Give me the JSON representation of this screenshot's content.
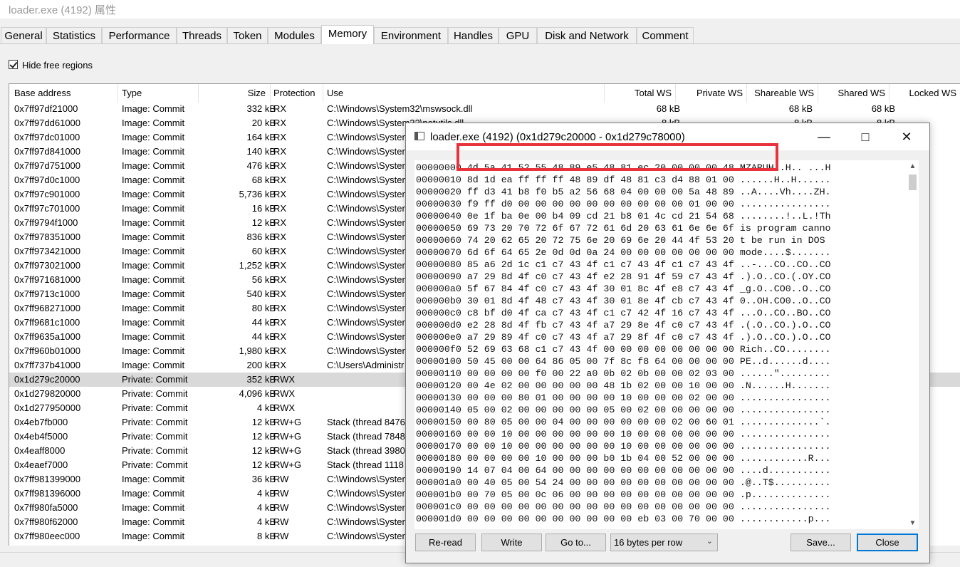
{
  "window_title": "loader.exe (4192) 属性",
  "tabs": [
    "General",
    "Statistics",
    "Performance",
    "Threads",
    "Token",
    "Modules",
    "Memory",
    "Environment",
    "Handles",
    "GPU",
    "Disk and Network",
    "Comment"
  ],
  "hide_free_label": "Hide free regions",
  "columns": [
    "Base address",
    "Type",
    "Size",
    "Protection",
    "Use",
    "Total WS",
    "Private WS",
    "Shareable WS",
    "Shared WS",
    "Locked WS"
  ],
  "rows": [
    {
      "addr": "0x7ff97df21000",
      "type": "Image: Commit",
      "size": "332 kB",
      "prot": "RX",
      "use": "C:\\Windows\\System32\\mswsock.dll",
      "tws": "68 kB",
      "sws": "68 kB",
      "shd": "68 kB"
    },
    {
      "addr": "0x7ff97dd61000",
      "type": "Image: Commit",
      "size": "20 kB",
      "prot": "RX",
      "use": "C:\\Windows\\System32\\netutils.dll",
      "tws": "8 kB",
      "sws": "8 kB",
      "shd": "8 kB"
    },
    {
      "addr": "0x7ff97dc01000",
      "type": "Image: Commit",
      "size": "164 kB",
      "prot": "RX",
      "use": "C:\\Windows\\System",
      "tws": "",
      "sws": "",
      "shd": ""
    },
    {
      "addr": "0x7ff97d841000",
      "type": "Image: Commit",
      "size": "140 kB",
      "prot": "RX",
      "use": "C:\\Windows\\System",
      "tws": "",
      "sws": "",
      "shd": ""
    },
    {
      "addr": "0x7ff97d751000",
      "type": "Image: Commit",
      "size": "476 kB",
      "prot": "RX",
      "use": "C:\\Windows\\System",
      "tws": "",
      "sws": "",
      "shd": ""
    },
    {
      "addr": "0x7ff97d0c1000",
      "type": "Image: Commit",
      "size": "68 kB",
      "prot": "RX",
      "use": "C:\\Windows\\System",
      "tws": "",
      "sws": "",
      "shd": ""
    },
    {
      "addr": "0x7ff97c901000",
      "type": "Image: Commit",
      "size": "5,736 kB",
      "prot": "RX",
      "use": "C:\\Windows\\System",
      "tws": "",
      "sws": "",
      "shd": ""
    },
    {
      "addr": "0x7ff97c701000",
      "type": "Image: Commit",
      "size": "16 kB",
      "prot": "RX",
      "use": "C:\\Windows\\System",
      "tws": "",
      "sws": "",
      "shd": ""
    },
    {
      "addr": "0x7ff9794f1000",
      "type": "Image: Commit",
      "size": "12 kB",
      "prot": "RX",
      "use": "C:\\Windows\\System",
      "tws": "",
      "sws": "",
      "shd": ""
    },
    {
      "addr": "0x7ff978351000",
      "type": "Image: Commit",
      "size": "836 kB",
      "prot": "RX",
      "use": "C:\\Windows\\System",
      "tws": "",
      "sws": "",
      "shd": ""
    },
    {
      "addr": "0x7ff973421000",
      "type": "Image: Commit",
      "size": "60 kB",
      "prot": "RX",
      "use": "C:\\Windows\\System",
      "tws": "",
      "sws": "",
      "shd": ""
    },
    {
      "addr": "0x7ff973021000",
      "type": "Image: Commit",
      "size": "1,252 kB",
      "prot": "RX",
      "use": "C:\\Windows\\System",
      "tws": "",
      "sws": "",
      "shd": ""
    },
    {
      "addr": "0x7ff971681000",
      "type": "Image: Commit",
      "size": "56 kB",
      "prot": "RX",
      "use": "C:\\Windows\\System",
      "tws": "",
      "sws": "",
      "shd": ""
    },
    {
      "addr": "0x7ff9713c1000",
      "type": "Image: Commit",
      "size": "540 kB",
      "prot": "RX",
      "use": "C:\\Windows\\System",
      "tws": "",
      "sws": "",
      "shd": ""
    },
    {
      "addr": "0x7ff968271000",
      "type": "Image: Commit",
      "size": "80 kB",
      "prot": "RX",
      "use": "C:\\Windows\\System",
      "tws": "",
      "sws": "",
      "shd": ""
    },
    {
      "addr": "0x7ff9681c1000",
      "type": "Image: Commit",
      "size": "44 kB",
      "prot": "RX",
      "use": "C:\\Windows\\System",
      "tws": "",
      "sws": "",
      "shd": ""
    },
    {
      "addr": "0x7ff9635a1000",
      "type": "Image: Commit",
      "size": "44 kB",
      "prot": "RX",
      "use": "C:\\Windows\\System",
      "tws": "",
      "sws": "",
      "shd": ""
    },
    {
      "addr": "0x7ff960b01000",
      "type": "Image: Commit",
      "size": "1,980 kB",
      "prot": "RX",
      "use": "C:\\Windows\\System",
      "tws": "",
      "sws": "",
      "shd": ""
    },
    {
      "addr": "0x7ff737b41000",
      "type": "Image: Commit",
      "size": "200 kB",
      "prot": "RX",
      "use": "C:\\Users\\Administr",
      "tws": "",
      "sws": "",
      "shd": ""
    },
    {
      "addr": "0x1d279c20000",
      "type": "Private: Commit",
      "size": "352 kB",
      "prot": "RWX",
      "use": "",
      "tws": "",
      "sws": "",
      "shd": "",
      "selected": true
    },
    {
      "addr": "0x1d279820000",
      "type": "Private: Commit",
      "size": "4,096 kB",
      "prot": "RWX",
      "use": "",
      "tws": "",
      "sws": "",
      "shd": ""
    },
    {
      "addr": "0x1d277950000",
      "type": "Private: Commit",
      "size": "4 kB",
      "prot": "RWX",
      "use": "",
      "tws": "",
      "sws": "",
      "shd": ""
    },
    {
      "addr": "0x4eb7fb000",
      "type": "Private: Commit",
      "size": "12 kB",
      "prot": "RW+G",
      "use": "Stack (thread 8476",
      "tws": "",
      "sws": "",
      "shd": ""
    },
    {
      "addr": "0x4eb4f5000",
      "type": "Private: Commit",
      "size": "12 kB",
      "prot": "RW+G",
      "use": "Stack (thread 7848",
      "tws": "",
      "sws": "",
      "shd": ""
    },
    {
      "addr": "0x4eaff8000",
      "type": "Private: Commit",
      "size": "12 kB",
      "prot": "RW+G",
      "use": "Stack (thread 3980",
      "tws": "",
      "sws": "",
      "shd": ""
    },
    {
      "addr": "0x4eaef7000",
      "type": "Private: Commit",
      "size": "12 kB",
      "prot": "RW+G",
      "use": "Stack (thread 1118",
      "tws": "",
      "sws": "",
      "shd": ""
    },
    {
      "addr": "0x7ff981399000",
      "type": "Image: Commit",
      "size": "36 kB",
      "prot": "RW",
      "use": "C:\\Windows\\System",
      "tws": "",
      "sws": "",
      "shd": ""
    },
    {
      "addr": "0x7ff981396000",
      "type": "Image: Commit",
      "size": "4 kB",
      "prot": "RW",
      "use": "C:\\Windows\\System",
      "tws": "",
      "sws": "",
      "shd": ""
    },
    {
      "addr": "0x7ff980fa5000",
      "type": "Image: Commit",
      "size": "4 kB",
      "prot": "RW",
      "use": "C:\\Windows\\System",
      "tws": "",
      "sws": "",
      "shd": ""
    },
    {
      "addr": "0x7ff980f62000",
      "type": "Image: Commit",
      "size": "4 kB",
      "prot": "RW",
      "use": "C:\\Windows\\System",
      "tws": "",
      "sws": "",
      "shd": ""
    },
    {
      "addr": "0x7ff980eec000",
      "type": "Image: Commit",
      "size": "8 kB",
      "prot": "RW",
      "use": "C:\\Windows\\System",
      "tws": "",
      "sws": "",
      "shd": ""
    }
  ],
  "memory_window": {
    "title": "loader.exe (4192) (0x1d279c20000 - 0x1d279c78000)",
    "hex_rows": [
      {
        "off": "00000000",
        "hex": "4d 5a 41 52 55 48 89 e5 48 81 ec 20 00 00 00 48",
        "ascii": "MZARUH..H.. ...H"
      },
      {
        "off": "00000010",
        "hex": "8d 1d ea ff ff ff 48 89 df 48 81 c3 d4 88 01 00",
        "ascii": "......H..H......"
      },
      {
        "off": "00000020",
        "hex": "ff d3 41 b8 f0 b5 a2 56 68 04 00 00 00 5a 48 89",
        "ascii": "..A....Vh....ZH."
      },
      {
        "off": "00000030",
        "hex": "f9 ff d0 00 00 00 00 00 00 00 00 00 00 01 00 00",
        "ascii": "................"
      },
      {
        "off": "00000040",
        "hex": "0e 1f ba 0e 00 b4 09 cd 21 b8 01 4c cd 21 54 68",
        "ascii": "........!..L.!Th"
      },
      {
        "off": "00000050",
        "hex": "69 73 20 70 72 6f 67 72 61 6d 20 63 61 6e 6e 6f",
        "ascii": "is program canno"
      },
      {
        "off": "00000060",
        "hex": "74 20 62 65 20 72 75 6e 20 69 6e 20 44 4f 53 20",
        "ascii": "t be run in DOS "
      },
      {
        "off": "00000070",
        "hex": "6d 6f 64 65 2e 0d 0d 0a 24 00 00 00 00 00 00 00",
        "ascii": "mode....$......."
      },
      {
        "off": "00000080",
        "hex": "85 a6 2d 1c c1 c7 43 4f c1 c7 43 4f c1 c7 43 4f",
        "ascii": "..-...CO..CO..CO"
      },
      {
        "off": "00000090",
        "hex": "a7 29 8d 4f c0 c7 43 4f e2 28 91 4f 59 c7 43 4f",
        "ascii": ".).O..CO.(.OY.CO"
      },
      {
        "off": "000000a0",
        "hex": "5f 67 84 4f c0 c7 43 4f 30 01 8c 4f e8 c7 43 4f",
        "ascii": "_g.O..CO0..O..CO"
      },
      {
        "off": "000000b0",
        "hex": "30 01 8d 4f 48 c7 43 4f 30 01 8e 4f cb c7 43 4f",
        "ascii": "0..OH.CO0..O..CO"
      },
      {
        "off": "000000c0",
        "hex": "c8 bf d0 4f ca c7 43 4f c1 c7 42 4f 16 c7 43 4f",
        "ascii": "...O..CO..BO..CO"
      },
      {
        "off": "000000d0",
        "hex": "e2 28 8d 4f fb c7 43 4f a7 29 8e 4f c0 c7 43 4f",
        "ascii": ".(.O..CO.).O..CO"
      },
      {
        "off": "000000e0",
        "hex": "a7 29 89 4f c0 c7 43 4f a7 29 8f 4f c0 c7 43 4f",
        "ascii": ".).O..CO.).O..CO"
      },
      {
        "off": "000000f0",
        "hex": "52 69 63 68 c1 c7 43 4f 00 00 00 00 00 00 00 00",
        "ascii": "Rich..CO........"
      },
      {
        "off": "00000100",
        "hex": "50 45 00 00 64 86 05 00 7f 8c f8 64 00 00 00 00",
        "ascii": "PE..d......d...."
      },
      {
        "off": "00000110",
        "hex": "00 00 00 00 f0 00 22 a0 0b 02 0b 00 00 02 03 00",
        "ascii": "......\"........."
      },
      {
        "off": "00000120",
        "hex": "00 4e 02 00 00 00 00 00 48 1b 02 00 00 10 00 00",
        "ascii": ".N......H......."
      },
      {
        "off": "00000130",
        "hex": "00 00 00 80 01 00 00 00 00 10 00 00 00 02 00 00",
        "ascii": "................"
      },
      {
        "off": "00000140",
        "hex": "05 00 02 00 00 00 00 00 05 00 02 00 00 00 00 00",
        "ascii": "................"
      },
      {
        "off": "00000150",
        "hex": "00 80 05 00 00 04 00 00 00 00 00 00 02 00 60 01",
        "ascii": "..............`."
      },
      {
        "off": "00000160",
        "hex": "00 00 10 00 00 00 00 00 00 10 00 00 00 00 00 00",
        "ascii": "................"
      },
      {
        "off": "00000170",
        "hex": "00 00 10 00 00 00 00 00 00 10 00 00 00 00 00 00",
        "ascii": "................"
      },
      {
        "off": "00000180",
        "hex": "00 00 00 00 10 00 00 00 b0 1b 04 00 52 00 00 00",
        "ascii": "............R..."
      },
      {
        "off": "00000190",
        "hex": "14 07 04 00 64 00 00 00 00 00 00 00 00 00 00 00",
        "ascii": "....d..........."
      },
      {
        "off": "000001a0",
        "hex": "00 40 05 00 54 24 00 00 00 00 00 00 00 00 00 00",
        "ascii": ".@..T$.........."
      },
      {
        "off": "000001b0",
        "hex": "00 70 05 00 0c 06 00 00 00 00 00 00 00 00 00 00",
        "ascii": ".p.............."
      },
      {
        "off": "000001c0",
        "hex": "00 00 00 00 00 00 00 00 00 00 00 00 00 00 00 00",
        "ascii": "................"
      },
      {
        "off": "000001d0",
        "hex": "00 00 00 00 00 00 00 00 00 00 eb 03 00 70 00 00",
        "ascii": "............p..."
      }
    ],
    "buttons": {
      "reread": "Re-read",
      "write": "Write",
      "goto": "Go to...",
      "save": "Save...",
      "close": "Close"
    },
    "bytes_per_row": "16 bytes per row",
    "highlight_color": "#e8323c"
  }
}
